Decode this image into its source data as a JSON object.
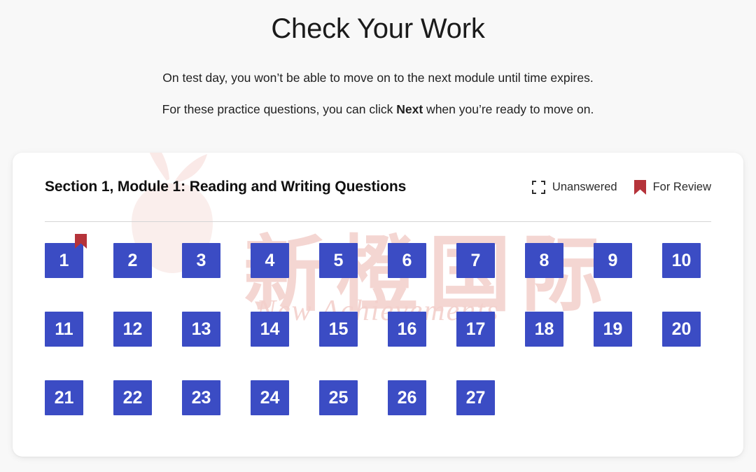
{
  "page": {
    "title": "Check Your Work",
    "intro_lines": [
      "On test day, you won’t be able to move on to the next module until time expires.",
      "For these practice questions, you can click Next when you’re ready to move on."
    ],
    "intro_line_1": "On test day, you won’t be able to move on to the next module until time expires.",
    "intro_line_2_before": "For these practice questions, you can click ",
    "intro_line_2_bold": "Next",
    "intro_line_2_after": " when you’re ready to move on.",
    "background_color": "#f8f8f8"
  },
  "card": {
    "section_title": "Section 1, Module 1: Reading and Writing Questions",
    "legend": [
      {
        "icon": "dashed-square-icon",
        "label": "Unanswered"
      },
      {
        "icon": "bookmark-flag-icon",
        "label": "For Review"
      }
    ],
    "accent_color": "#3b4cc4",
    "review_color": "#b5333a",
    "rows": [
      [
        {
          "number": "1",
          "flagged": true
        },
        {
          "number": "2",
          "flagged": false
        },
        {
          "number": "3",
          "flagged": false
        },
        {
          "number": "4",
          "flagged": false
        },
        {
          "number": "5",
          "flagged": false
        },
        {
          "number": "6",
          "flagged": false
        },
        {
          "number": "7",
          "flagged": false
        },
        {
          "number": "8",
          "flagged": false
        },
        {
          "number": "9",
          "flagged": false
        },
        {
          "number": "10",
          "flagged": false
        }
      ],
      [
        {
          "number": "11",
          "flagged": false
        },
        {
          "number": "12",
          "flagged": false
        },
        {
          "number": "13",
          "flagged": false
        },
        {
          "number": "14",
          "flagged": false
        },
        {
          "number": "15",
          "flagged": false
        },
        {
          "number": "16",
          "flagged": false
        },
        {
          "number": "17",
          "flagged": false
        },
        {
          "number": "18",
          "flagged": false
        },
        {
          "number": "19",
          "flagged": false
        },
        {
          "number": "20",
          "flagged": false
        }
      ],
      [
        {
          "number": "21",
          "flagged": false
        },
        {
          "number": "22",
          "flagged": false
        },
        {
          "number": "23",
          "flagged": false
        },
        {
          "number": "24",
          "flagged": false
        },
        {
          "number": "25",
          "flagged": false
        },
        {
          "number": "26",
          "flagged": false
        },
        {
          "number": "27",
          "flagged": false
        }
      ]
    ]
  },
  "watermark": {
    "chinese_text": "新橙国际",
    "english_text": "New Achievements",
    "logo": "orange-fruit-logo",
    "color": "#f3cfcb"
  }
}
